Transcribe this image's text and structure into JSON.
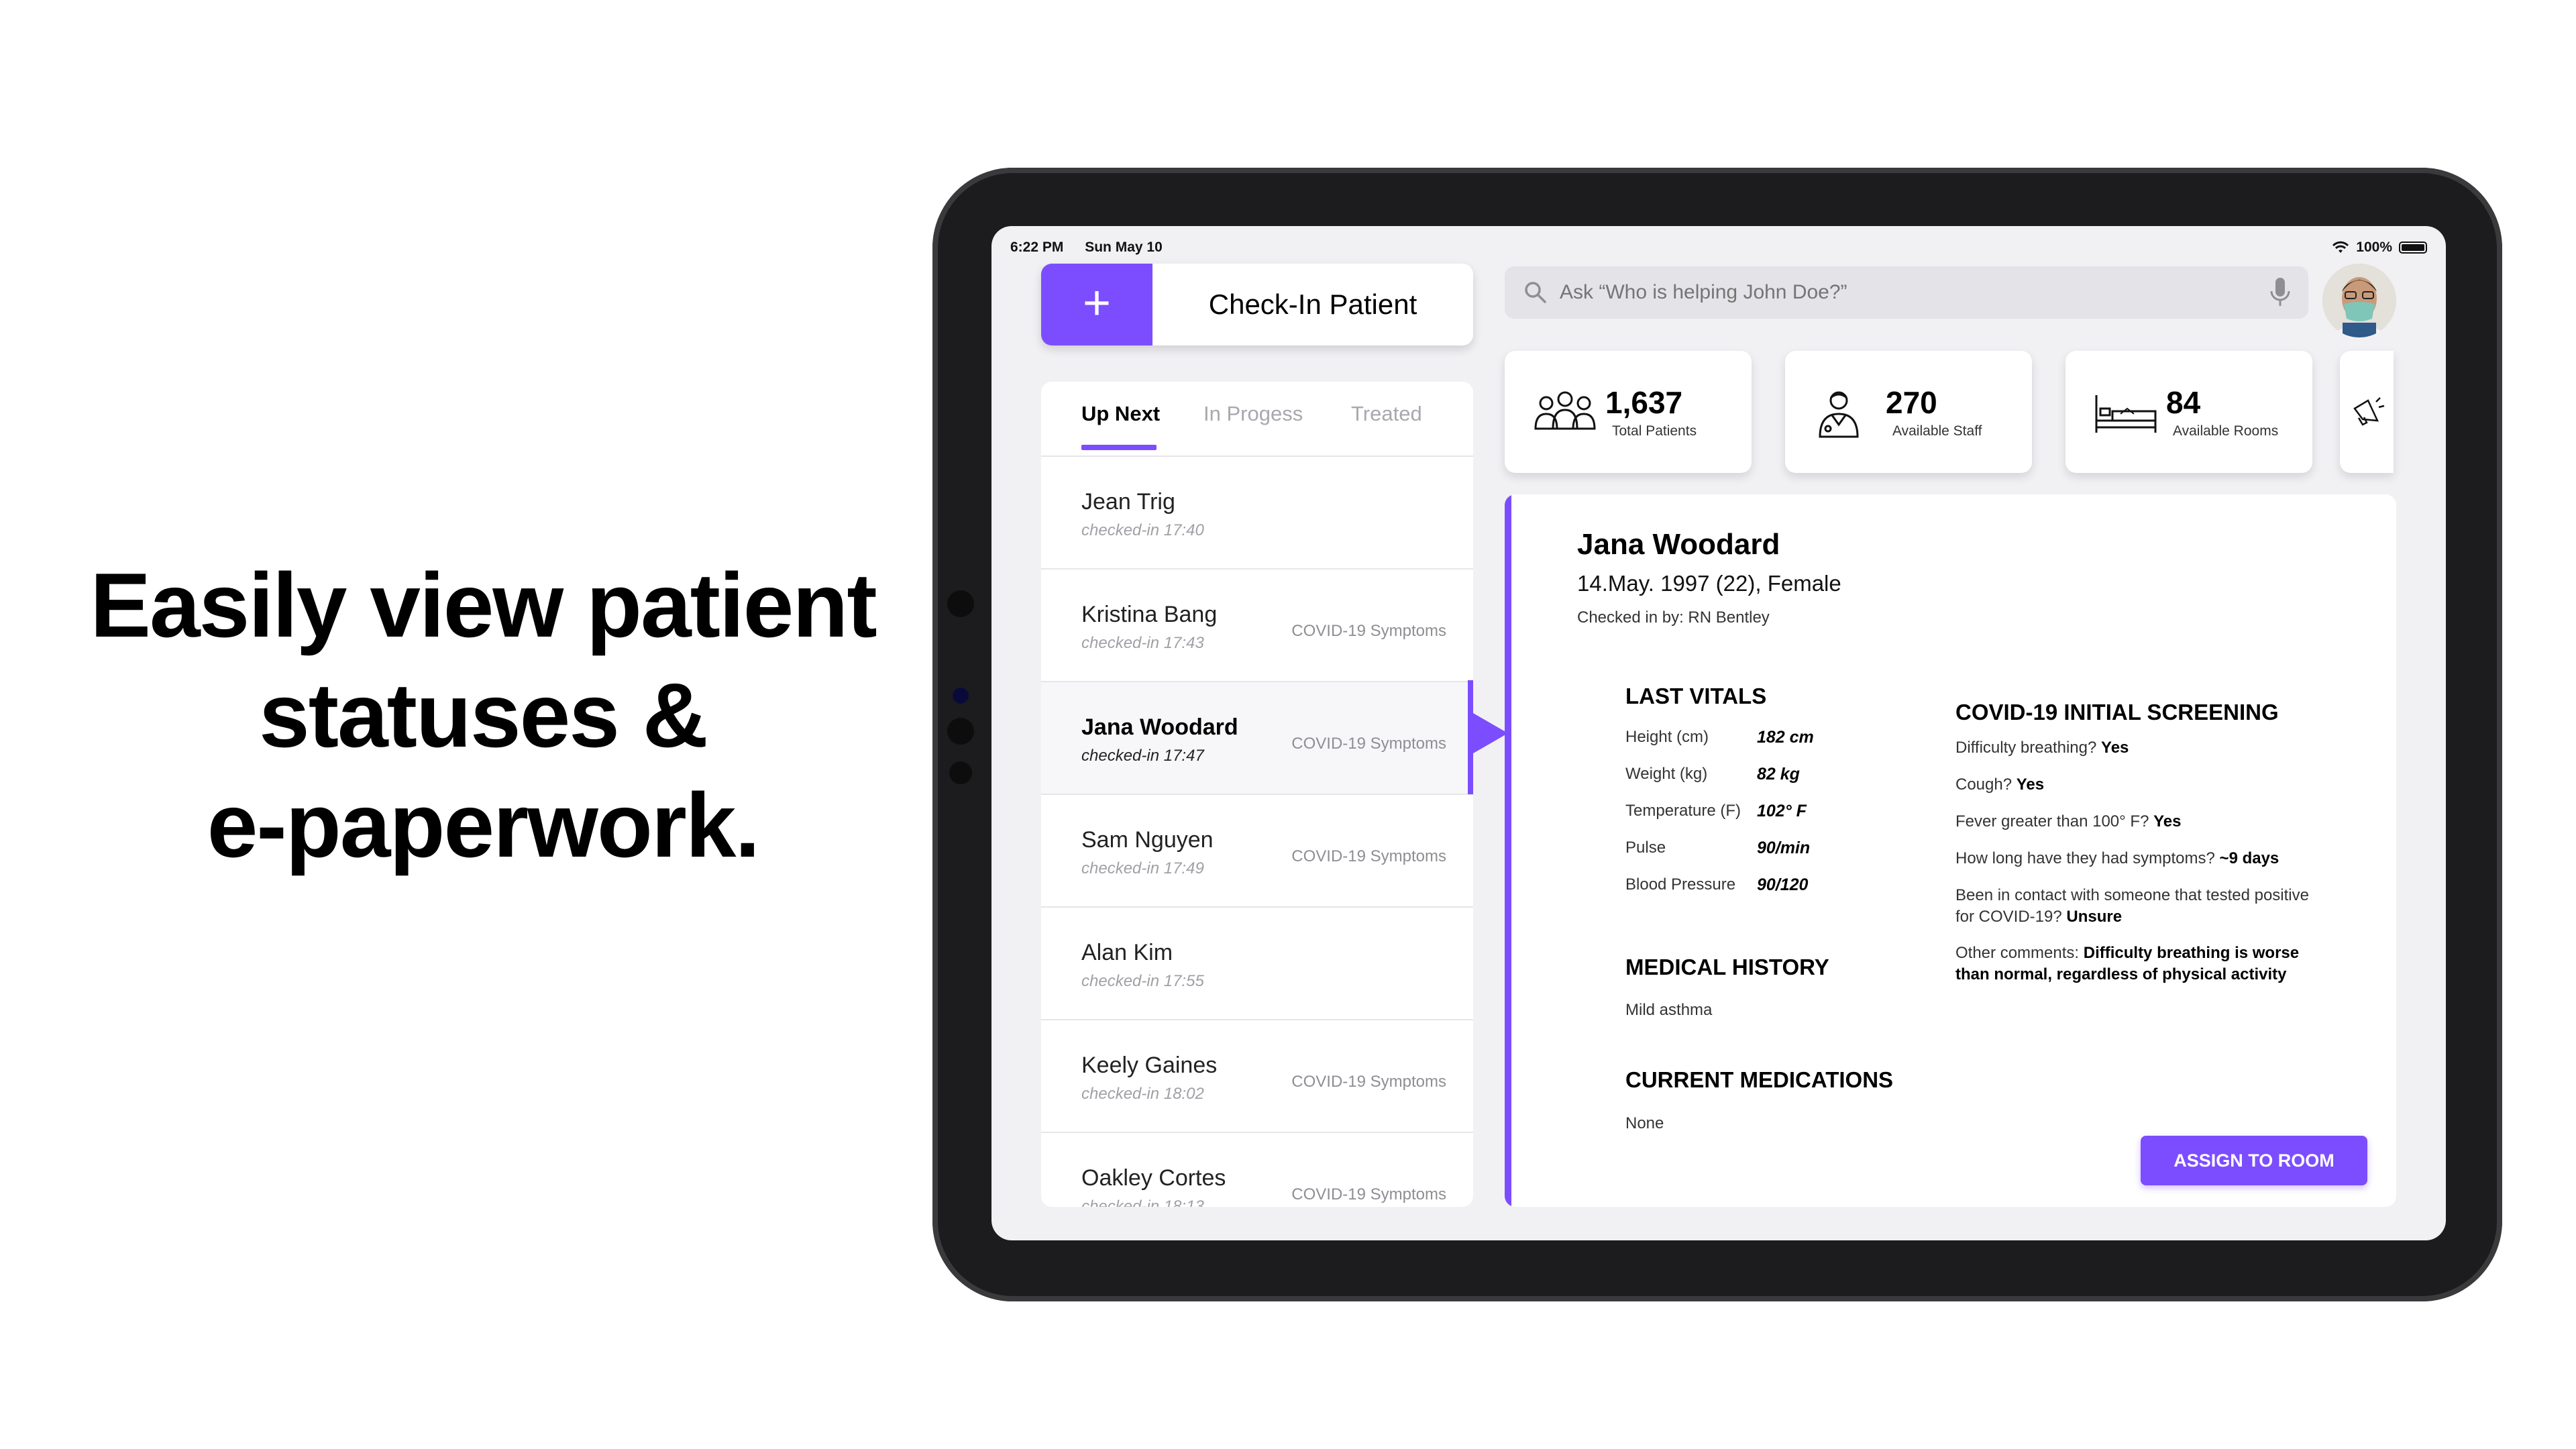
{
  "headline": {
    "line1": "Easily view patient",
    "line2": "statuses &",
    "line3": "e-paperwork."
  },
  "status_bar": {
    "time": "6:22 PM",
    "date": "Sun May 10",
    "battery": "100%"
  },
  "checkin": {
    "plus_icon": "plus-icon",
    "label": "Check-In Patient"
  },
  "search": {
    "placeholder": "Ask “Who is helping John Doe?”",
    "icon": "search-icon",
    "mic_icon": "microphone-icon"
  },
  "stats": [
    {
      "value": "1,637",
      "label": "Total Patients",
      "icon": "patients-group-icon"
    },
    {
      "value": "270",
      "label": "Available Staff",
      "icon": "doctor-icon"
    },
    {
      "value": "84",
      "label": "Available Rooms",
      "icon": "hospital-bed-icon"
    }
  ],
  "more_icon": "megaphone-icon",
  "queue": {
    "tabs": [
      "Up Next",
      "In Progess",
      "Treated"
    ],
    "active_tab": "Up Next",
    "patients": [
      {
        "name": "Jean Trig",
        "time": "checked-in 17:40",
        "tag": ""
      },
      {
        "name": "Kristina Bang",
        "time": "checked-in 17:43",
        "tag": "COVID-19 Symptoms"
      },
      {
        "name": "Jana Woodard",
        "time": "checked-in 17:47",
        "tag": "COVID-19 Symptoms",
        "selected": true
      },
      {
        "name": "Sam Nguyen",
        "time": "checked-in 17:49",
        "tag": "COVID-19 Symptoms"
      },
      {
        "name": "Alan Kim",
        "time": "checked-in 17:55",
        "tag": ""
      },
      {
        "name": "Keely Gaines",
        "time": "checked-in 18:02",
        "tag": "COVID-19 Symptoms"
      },
      {
        "name": "Oakley Cortes",
        "time": "checked-in 18:13",
        "tag": "COVID-19 Symptoms"
      }
    ]
  },
  "detail": {
    "name": "Jana Woodard",
    "dob_line": "14.May. 1997 (22), Female",
    "checked_in_by": "Checked in by: RN Bentley",
    "vitals_title": "LAST VITALS",
    "vitals": [
      {
        "label": "Height (cm)",
        "value": "182 cm"
      },
      {
        "label": "Weight (kg)",
        "value": "82 kg"
      },
      {
        "label": "Temperature (F)",
        "value": "102° F"
      },
      {
        "label": "Pulse",
        "value": "90/min"
      },
      {
        "label": "Blood Pressure",
        "value": "90/120"
      }
    ],
    "history_title": "MEDICAL HISTORY",
    "history": "Mild asthma",
    "meds_title": "CURRENT MEDICATIONS",
    "meds": "None",
    "screening_title": "COVID-19 INITIAL SCREENING",
    "screening": {
      "q1": "Difficulty breathing?",
      "a1": "Yes",
      "q2": "Cough?",
      "a2": "Yes",
      "q3": "Fever greater than 100° F?",
      "a3": "Yes",
      "q4": "How long have they had symptoms?",
      "a4": "~9 days",
      "q5": "Been in contact with someone that tested positive for COVID-19?",
      "a5": "Unsure",
      "q6": "Other comments:",
      "a6": "Difficulty breathing is worse than normal, regardless of physical activity"
    },
    "assign_button": "ASSIGN TO ROOM"
  },
  "colors": {
    "accent": "#7c4dff",
    "panel_bg": "#f1f1f4",
    "device": "#1c1c1e"
  }
}
